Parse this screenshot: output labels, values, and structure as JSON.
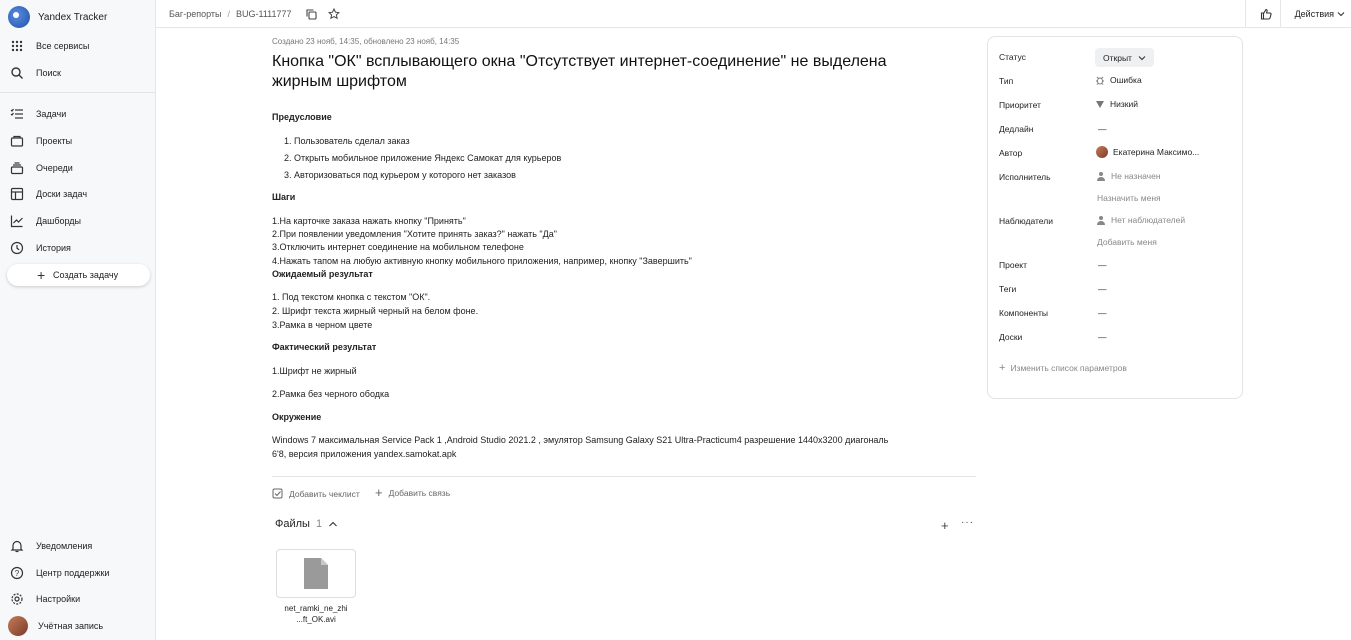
{
  "app": {
    "name": "Yandex Tracker"
  },
  "sidebar": {
    "top_items": [
      {
        "label": "Все сервисы",
        "icon": "grid-icon"
      },
      {
        "label": "Поиск",
        "icon": "search-icon"
      }
    ],
    "items": [
      {
        "label": "Задачи",
        "icon": "tasks-icon"
      },
      {
        "label": "Проекты",
        "icon": "projects-icon"
      },
      {
        "label": "Очереди",
        "icon": "queues-icon"
      },
      {
        "label": "Доски задач",
        "icon": "boards-icon"
      },
      {
        "label": "Дашборды",
        "icon": "dashboards-icon"
      },
      {
        "label": "История",
        "icon": "history-icon"
      }
    ],
    "create_label": "Создать задачу",
    "bottom_items": [
      {
        "label": "Уведомления",
        "icon": "bell-icon"
      },
      {
        "label": "Центр поддержки",
        "icon": "help-icon"
      },
      {
        "label": "Настройки",
        "icon": "gear-icon"
      },
      {
        "label": "Учётная запись",
        "icon": "avatar"
      }
    ]
  },
  "topbar": {
    "breadcrumb_queue": "Баг-репорты",
    "breadcrumb_sep": "/",
    "issue_key": "BUG-1111777",
    "actions_label": "Действия"
  },
  "issue": {
    "meta": "Создано 23 нояб, 14:35, обновлено 23 нояб, 14:35",
    "title": "Кнопка \"ОК\" всплывающего окна \"Отсутствует интернет-соединение\" не выделена жирным шрифтом",
    "precondition_h": "Предусловие",
    "precondition": [
      "1. Пользователь сделал заказ",
      "2. Открыть мобильное приложение Яндекс Самокат для курьеров",
      "3. Авторизоваться под курьером у которого нет заказов"
    ],
    "steps_h": "Шаги",
    "steps": [
      "1.На карточке заказа нажать кнопку \"Принять\"",
      "2.При появлении уведомления \"Хотите принять заказ?\" нажать \"Да\"",
      "3.Отключить интернет соединение на мобильном телефоне",
      "4.Нажать тапом на любую активную кнопку мобильного приложения, например, кнопку \"Завершить\""
    ],
    "expected_h": "Ожидаемый результат",
    "expected": [
      "1. Под текстом кнопка с текстом \"ОК\".",
      "2. Шрифт текста жирный черный на белом фоне.",
      "3.Рамка в черном цвете"
    ],
    "actual_h": "Фактический результат",
    "actual": [
      "1.Шрифт не жирный",
      "2.Рамка без черного ободка"
    ],
    "env_h": "Окружение",
    "env": [
      "Windows 7 максимальная Service Pack 1 ,Android Studio 2021.2 , эмулятор Samsung Galaxy S21 Ultra-Practicum4 разрешение 1440х3200 диагональ",
      "6'8, версия приложения yandex.samokat.apk"
    ],
    "add_checklist": "Добавить чеклист",
    "add_link": "Добавить связь",
    "files_label": "Файлы",
    "files_count": "1",
    "file_name_line1": "net_ramki_ne_zhi",
    "file_name_line2": "...ft_OK.avi"
  },
  "panel": {
    "status_label": "Статус",
    "status_value": "Открыт",
    "type_label": "Тип",
    "type_value": "Ошибка",
    "priority_label": "Приоритет",
    "priority_value": "Низкий",
    "deadline_label": "Дедлайн",
    "deadline_value": "—",
    "author_label": "Автор",
    "author_value": "Екатерина Максимо...",
    "assignee_label": "Исполнитель",
    "assignee_value": "Не назначен",
    "assign_me": "Назначить меня",
    "followers_label": "Наблюдатели",
    "followers_value": "Нет наблюдателей",
    "add_me": "Добавить меня",
    "project_label": "Проект",
    "project_value": "—",
    "tags_label": "Теги",
    "tags_value": "—",
    "components_label": "Компоненты",
    "components_value": "—",
    "boards_label": "Доски",
    "boards_value": "—",
    "change_params": "Изменить список параметров"
  },
  "colors": {
    "accent": "#1f4fa8",
    "panel_border": "#e3e3e3",
    "pill_bg": "#eef0f2"
  }
}
